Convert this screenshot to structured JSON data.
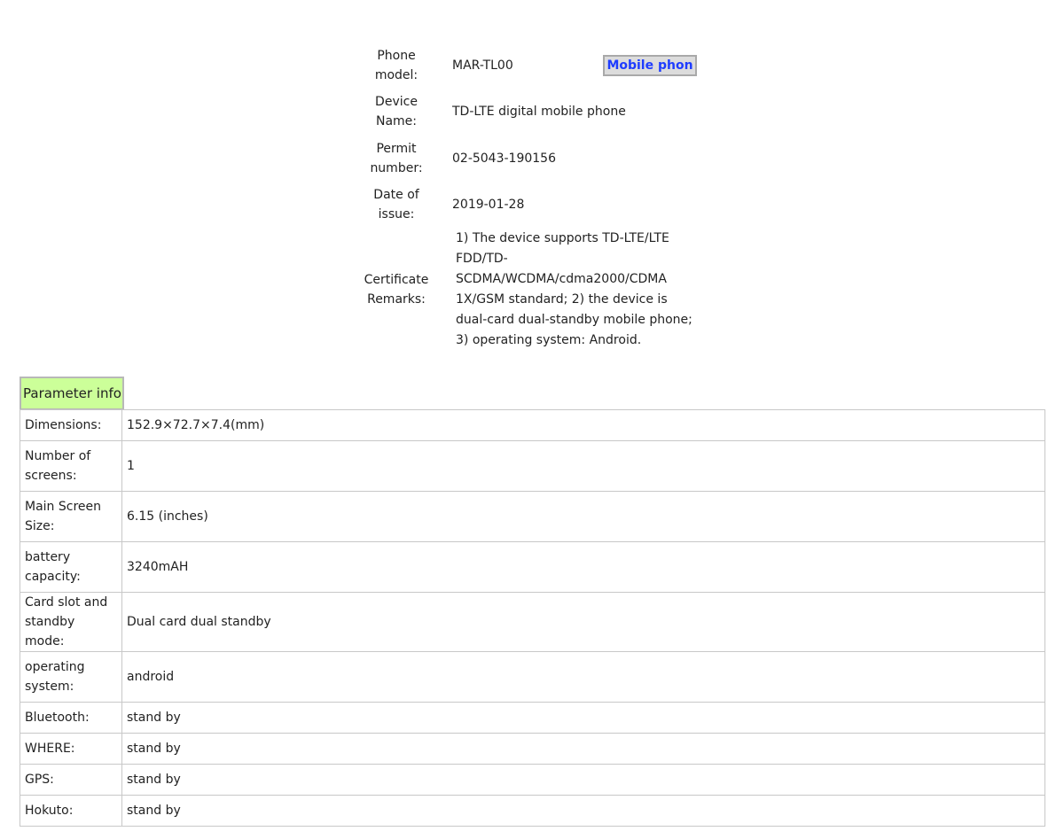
{
  "certificate": {
    "phone_model_label": "Phone model:",
    "phone_model_value": "MAR-TL00",
    "mobile_tab_label": "Mobile phon",
    "device_name_label": "Device Name:",
    "device_name_value": "TD-LTE digital mobile phone",
    "permit_number_label": "Permit number:",
    "permit_number_value": "02-5043-190156",
    "date_of_issue_label": "Date of issue:",
    "date_of_issue_value": "2019-01-28",
    "remarks_label": "Certificate Remarks:",
    "remarks_lines": [
      "1) The device supports TD-LTE/LTE",
      "FDD/TD-",
      "SCDMA/WCDMA/cdma2000/CDMA",
      "1X/GSM standard; 2) the device is",
      "dual-card dual-standby mobile phone;",
      "3) operating system: Android."
    ]
  },
  "parameter_info": {
    "header": "Parameter info",
    "rows": [
      {
        "label": "Dimensions:",
        "value": "152.9×72.7×7.4(mm)"
      },
      {
        "label": "Number of screens:",
        "value": "1"
      },
      {
        "label": "Main Screen Size:",
        "value": "6.15 (inches)"
      },
      {
        "label": "battery capacity:",
        "value": "3240mAH"
      },
      {
        "label": "Card slot and standby mode:",
        "value": "Dual card dual standby"
      },
      {
        "label": "operating system:",
        "value": "android"
      },
      {
        "label": "Bluetooth:",
        "value": "stand by"
      },
      {
        "label": "WHERE:",
        "value": "stand by"
      },
      {
        "label": "GPS:",
        "value": "stand by"
      },
      {
        "label": "Hokuto:",
        "value": "stand by"
      }
    ]
  },
  "colors": {
    "param_header_bg": "#ccff99",
    "mobile_tab_text": "#1e3cff",
    "mobile_tab_bg": "#dcdcdc",
    "table_border": "#c8c8c8"
  }
}
